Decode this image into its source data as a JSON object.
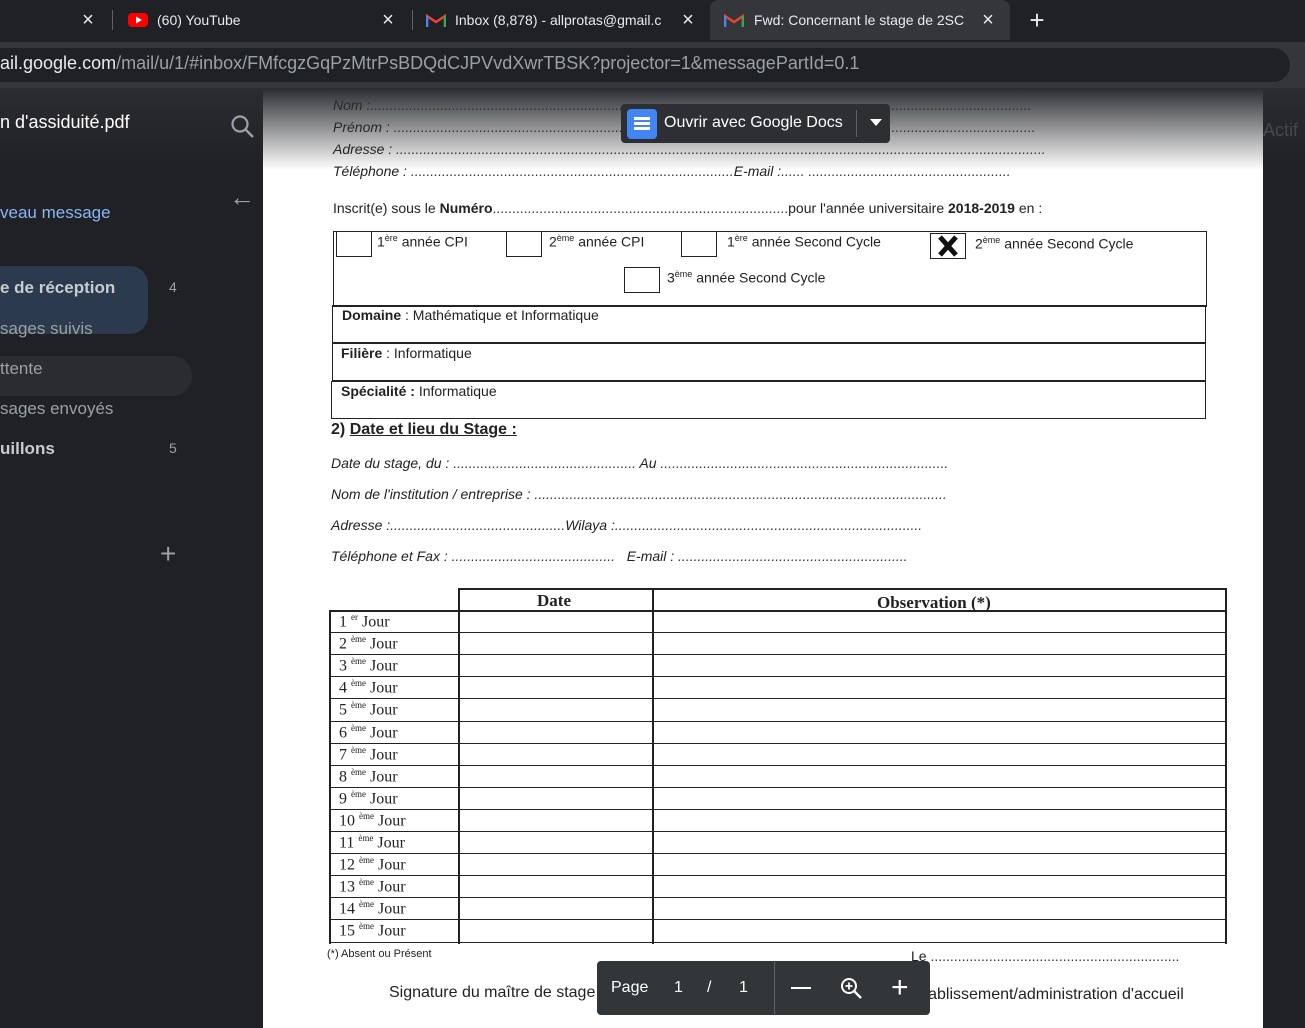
{
  "browser": {
    "tabs": [
      {
        "title": "(60) YouTube",
        "icon": "youtube-icon"
      },
      {
        "title": "Inbox (8,878) - allprotas@gmail.c",
        "icon": "gmail-icon"
      },
      {
        "title": "Fwd: Concernant le stage de 2SC",
        "icon": "gmail-icon"
      }
    ],
    "url_host": "ail.google.com",
    "url_path": "/mail/u/1/#inbox/FMfcgzGqPzMtrPsBDQdCJPVvdXwrTBSK?projector=1&messagePartId=0.1"
  },
  "gmail_bg": {
    "compose": "veau message",
    "inbox": "e de réception",
    "inbox_count": "4",
    "starred": "sages suivis",
    "snoozed": "ttente",
    "sent": "sages envoyés",
    "drafts": "uillons",
    "drafts_count": "5",
    "right_label": "Actif"
  },
  "viewer": {
    "file_name": "n d'assiduité.pdf",
    "open_with": "Ouvrir avec Google Docs",
    "page_label": "Page",
    "page_current": "1",
    "page_sep": "/",
    "page_total": "1"
  },
  "doc": {
    "nom": "Nom :",
    "prenom": "Prénom :",
    "adresse": "Adresse :",
    "telephone": "Téléphone :",
    "email": "E-mail :",
    "inscrit_pre": "Inscrit(e) sous le",
    "inscrit_numero": "Numéro",
    "inscrit_mid": "pour l'année universitaire",
    "inscrit_year": "2018-2019",
    "inscrit_post": "en :",
    "years": {
      "y1": {
        "n": "1",
        "sup": "ère",
        "label": "année CPI"
      },
      "y2": {
        "n": "2",
        "sup": "ème",
        "label": "année CPI"
      },
      "y3": {
        "n": "1",
        "sup": "ère",
        "label": "année Second Cycle"
      },
      "y4": {
        "n": "2",
        "sup": "ème",
        "label": "année Second Cycle",
        "checked": true
      },
      "y5": {
        "n": "3",
        "sup": "ème",
        "label": "année Second Cycle"
      }
    },
    "domaine_label": "Domaine",
    "domaine_value": ": Mathématique et Informatique",
    "filiere_label": "Filière",
    "filiere_value": ": Informatique",
    "specialite_label": "Spécialité :",
    "specialite_value": "Informatique",
    "section2": "Date et lieu du Stage :",
    "section2_num": "2)",
    "date_stage": "Date du stage, du :",
    "au": "Au",
    "institution": "Nom de l'institution / entreprise :",
    "adresse2": "Adresse :",
    "wilaya": "Wilaya :",
    "tel_fax": "Téléphone et Fax :",
    "email2": "E-mail :",
    "col_date": "Date",
    "col_obs": "Observation (*)",
    "days": [
      {
        "n": "1",
        "sup": "er"
      },
      {
        "n": "2",
        "sup": "ème"
      },
      {
        "n": "3",
        "sup": "ème"
      },
      {
        "n": "4",
        "sup": "ème"
      },
      {
        "n": "5",
        "sup": "ème"
      },
      {
        "n": "6",
        "sup": "ème"
      },
      {
        "n": "7",
        "sup": "ème"
      },
      {
        "n": "8",
        "sup": "ème"
      },
      {
        "n": "9",
        "sup": "ème"
      },
      {
        "n": "10",
        "sup": "ème"
      },
      {
        "n": "11",
        "sup": "ème"
      },
      {
        "n": "12",
        "sup": "ème"
      },
      {
        "n": "13",
        "sup": "ème"
      },
      {
        "n": "14",
        "sup": "ème"
      },
      {
        "n": "15",
        "sup": "ème"
      }
    ],
    "day_word": "Jour",
    "footnote": "(*) Absent ou Présent",
    "le": "Le",
    "sig_left": "Signature du maître de stage",
    "sig_right": "Etablissement/administration d'accueil"
  }
}
